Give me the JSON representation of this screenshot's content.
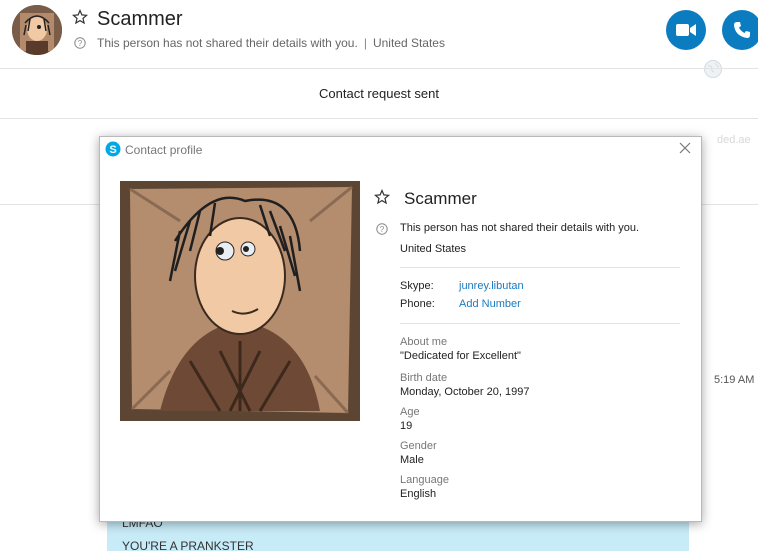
{
  "header": {
    "name": "Scammer",
    "details_note": "This person has not shared their details with you.",
    "separator": "|",
    "country": "United States"
  },
  "chat": {
    "request_status": "Contact request sent",
    "timestamp": "5:19 AM",
    "faint_text": "ded.ae",
    "messages": [
      "LMFAO",
      "YOU'RE A PRANKSTER"
    ]
  },
  "dialog": {
    "title": "Contact profile",
    "name": "Scammer",
    "details_note": "This person has not shared their details with you.",
    "country": "United States",
    "skype_label": "Skype:",
    "skype_value": "junrey.libutan",
    "phone_label": "Phone:",
    "phone_value": "Add Number",
    "fields": [
      {
        "label": "About me",
        "value": "\"Dedicated for Excellent\""
      },
      {
        "label": "Birth date",
        "value": "Monday, October 20, 1997"
      },
      {
        "label": "Age",
        "value": "19"
      },
      {
        "label": "Gender",
        "value": "Male"
      },
      {
        "label": "Language",
        "value": "English"
      }
    ]
  },
  "colors": {
    "accent": "#0c7cc1",
    "link": "#1a7bbf",
    "bubble": "#c7ebf7"
  },
  "icons": [
    "star-icon",
    "question-icon",
    "video-icon",
    "phone-icon",
    "globe-icon",
    "skype-logo-icon",
    "close-icon"
  ]
}
